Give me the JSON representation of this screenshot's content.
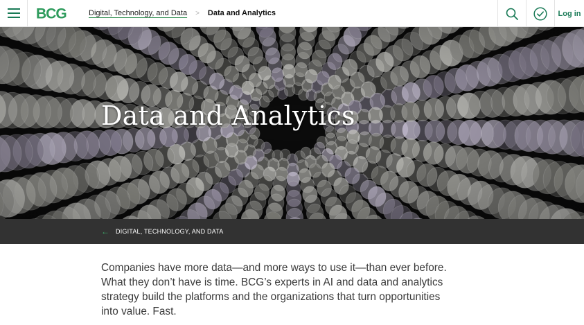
{
  "header": {
    "logo_text": "BCG",
    "breadcrumb": {
      "parent": "Digital, Technology, and Data",
      "separator": ">",
      "current": "Data and Analytics"
    },
    "login_label": "Log in",
    "icons": [
      "menu-icon",
      "search-icon",
      "check-circle-icon"
    ]
  },
  "hero": {
    "title": "Data and Analytics"
  },
  "backbar": {
    "arrow": "←",
    "label": "DIGITAL, TECHNOLOGY, AND DATA"
  },
  "intro": {
    "text": "Companies have more data—and more ways to use it—than ever before. What they don’t have is time. BCG’s experts in AI and data and analytics strategy build the platforms and the organizations that turn opportunities into value. Fast."
  },
  "colors": {
    "brand_green": "#197a56",
    "accent_green": "#3ea76a",
    "dark_bar": "#323232"
  }
}
